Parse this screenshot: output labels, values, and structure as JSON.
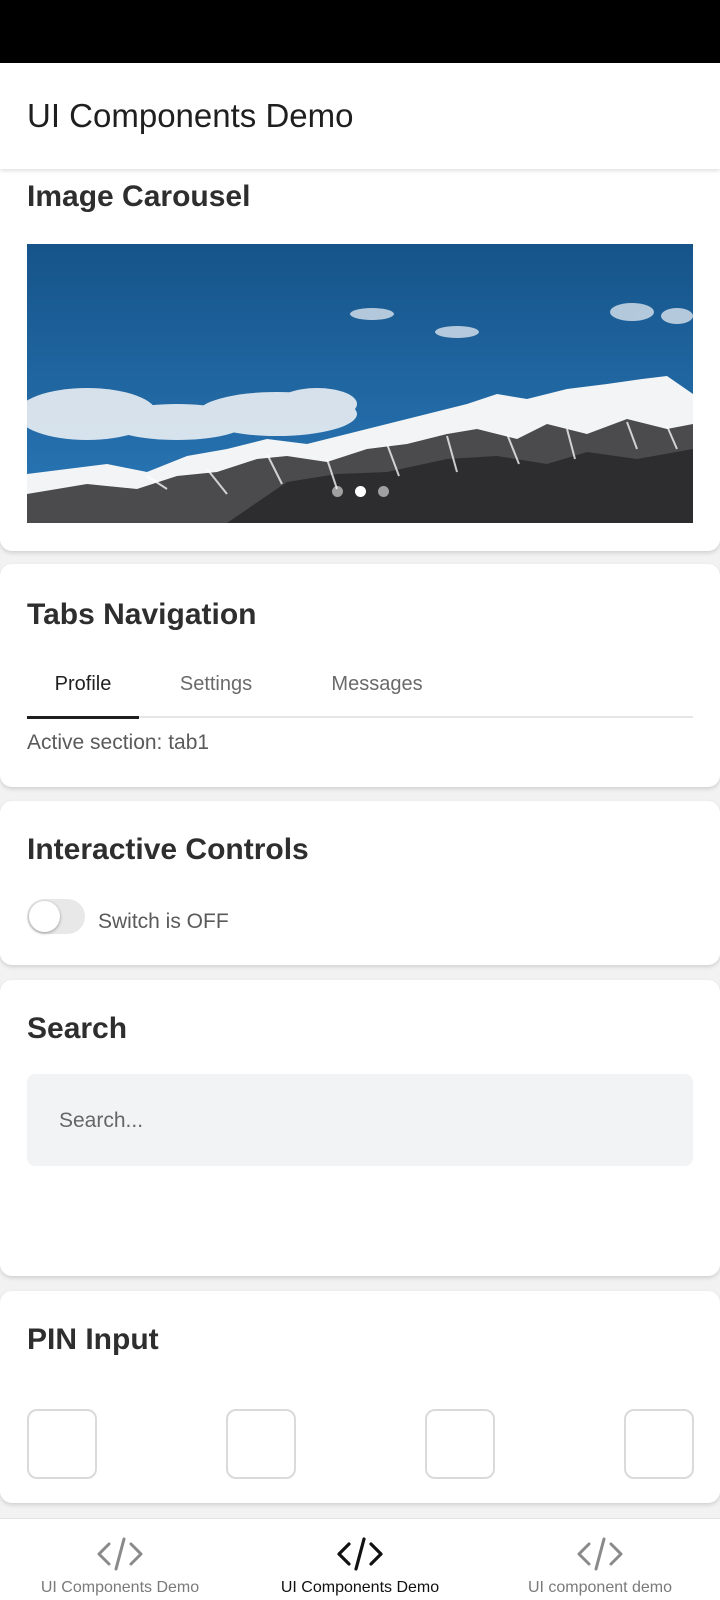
{
  "app": {
    "title": "UI Components Demo"
  },
  "carousel": {
    "title": "Image Carousel",
    "slide_count": 3,
    "active_index": 1
  },
  "tabs": {
    "title": "Tabs Navigation",
    "items": [
      {
        "label": "Profile",
        "active": true
      },
      {
        "label": "Settings",
        "active": false
      },
      {
        "label": "Messages",
        "active": false
      }
    ],
    "active_section_text": "Active section: tab1"
  },
  "controls": {
    "title": "Interactive Controls",
    "switch_on": false,
    "switch_label": "Switch is OFF"
  },
  "search": {
    "title": "Search",
    "placeholder": "Search...",
    "value": ""
  },
  "pin": {
    "title": "PIN Input",
    "digits": [
      "",
      "",
      "",
      ""
    ]
  },
  "bottom_nav": {
    "items": [
      {
        "label": "UI Components Demo",
        "icon": "code-icon",
        "active": false
      },
      {
        "label": "UI Components Demo",
        "icon": "code-icon",
        "active": true
      },
      {
        "label": "UI component demo",
        "icon": "code-icon",
        "active": false
      }
    ]
  },
  "colors": {
    "accent": "#1f1f1f",
    "inactive": "#7a7a7a",
    "status_bar": "#000000",
    "search_bg": "#f2f3f5"
  }
}
